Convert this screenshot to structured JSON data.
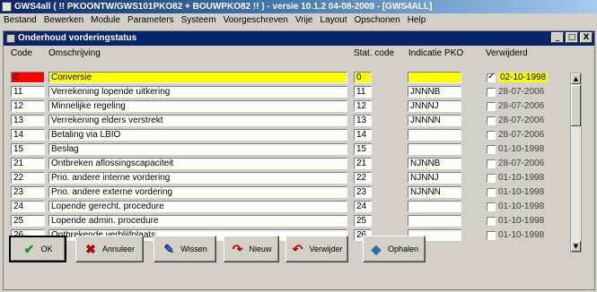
{
  "titlebar": {
    "title": "GWS4all ( !! PKOONTW/GWS101PKO82 + BOUWPKO82 !! ) - versie 10.1.2    04-08-2009 - [GWS4ALL]"
  },
  "menu": [
    "Bestand",
    "Bewerken",
    "Module",
    "Parameters",
    "Systeem",
    "Voorgeschreven",
    "Vrije",
    "Layout",
    "Opschonen",
    "Help"
  ],
  "window": {
    "title": "Onderhoud vorderingstatus",
    "controls": [
      "_",
      "□",
      "X"
    ]
  },
  "columns": {
    "code": "Code",
    "desc": "Omschrijving",
    "stat": "Stat. code",
    "pko": "Indicatie PKO",
    "del": "Verwijderd"
  },
  "rows": [
    {
      "code": "0",
      "desc": "Conversie",
      "stat": "0",
      "pko": "",
      "checked": true,
      "date": "02-10-1998",
      "highlight": true
    },
    {
      "code": "11",
      "desc": "Verrekening lopende uitkering",
      "stat": "11",
      "pko": "JNNNB",
      "checked": false,
      "date": "28-07-2006"
    },
    {
      "code": "12",
      "desc": "Minnelijke regeling",
      "stat": "12",
      "pko": "JNNNJ",
      "checked": false,
      "date": "28-07-2006"
    },
    {
      "code": "13",
      "desc": "Verrekening elders verstrekt",
      "stat": "13",
      "pko": "JNNNN",
      "checked": false,
      "date": "28-07-2006"
    },
    {
      "code": "14",
      "desc": "Betaling via LBIO",
      "stat": "14",
      "pko": "",
      "checked": false,
      "date": "28-07-2006"
    },
    {
      "code": "15",
      "desc": "Beslag",
      "stat": "15",
      "pko": "",
      "checked": false,
      "date": "01-10-1998"
    },
    {
      "code": "21",
      "desc": "Ontbreken aflossingscapaciteit",
      "stat": "21",
      "pko": "NJNNB",
      "checked": false,
      "date": "28-07-2006"
    },
    {
      "code": "22",
      "desc": "Prio. andere interne vordering",
      "stat": "22",
      "pko": "NJNNJ",
      "checked": false,
      "date": "01-10-1998"
    },
    {
      "code": "23",
      "desc": "Prio. andere externe vordering",
      "stat": "23",
      "pko": "NJNNN",
      "checked": false,
      "date": "01-10-1998"
    },
    {
      "code": "24",
      "desc": "Lopende gerecht. procedure",
      "stat": "24",
      "pko": "",
      "checked": false,
      "date": "01-10-1998"
    },
    {
      "code": "25",
      "desc": "Lopende admin. procedure",
      "stat": "25",
      "pko": "",
      "checked": false,
      "date": "01-10-1998"
    },
    {
      "code": "26",
      "desc": "Ontbrekende verblijfplaats",
      "stat": "26",
      "pko": "",
      "checked": false,
      "date": "01-10-1998"
    }
  ],
  "scrollbar": {
    "up": "▲",
    "down": "▼"
  },
  "buttons": [
    {
      "name": "ok-button",
      "label": "OK",
      "icon": "check-icon",
      "glyph": "✔",
      "color": "#1a8f1a"
    },
    {
      "name": "annuleer-button",
      "label": "Annuleer",
      "icon": "cancel-x-icon",
      "glyph": "✖",
      "color": "#b00000"
    },
    {
      "name": "wissen-button",
      "label": "Wissen",
      "icon": "eraser-icon",
      "glyph": "✎",
      "color": "#1a3a8f"
    },
    {
      "name": "nieuw-button",
      "label": "Nieuw",
      "icon": "new-icon",
      "glyph": "↷",
      "color": "#c00000"
    },
    {
      "name": "verwijder-button",
      "label": "Verwijder",
      "icon": "delete-icon",
      "glyph": "↶",
      "color": "#c00000"
    },
    {
      "name": "ophalen-button",
      "label": "Ophalen",
      "icon": "retrieve-icon",
      "glyph": "◆",
      "color": "#2a6ab0"
    }
  ]
}
